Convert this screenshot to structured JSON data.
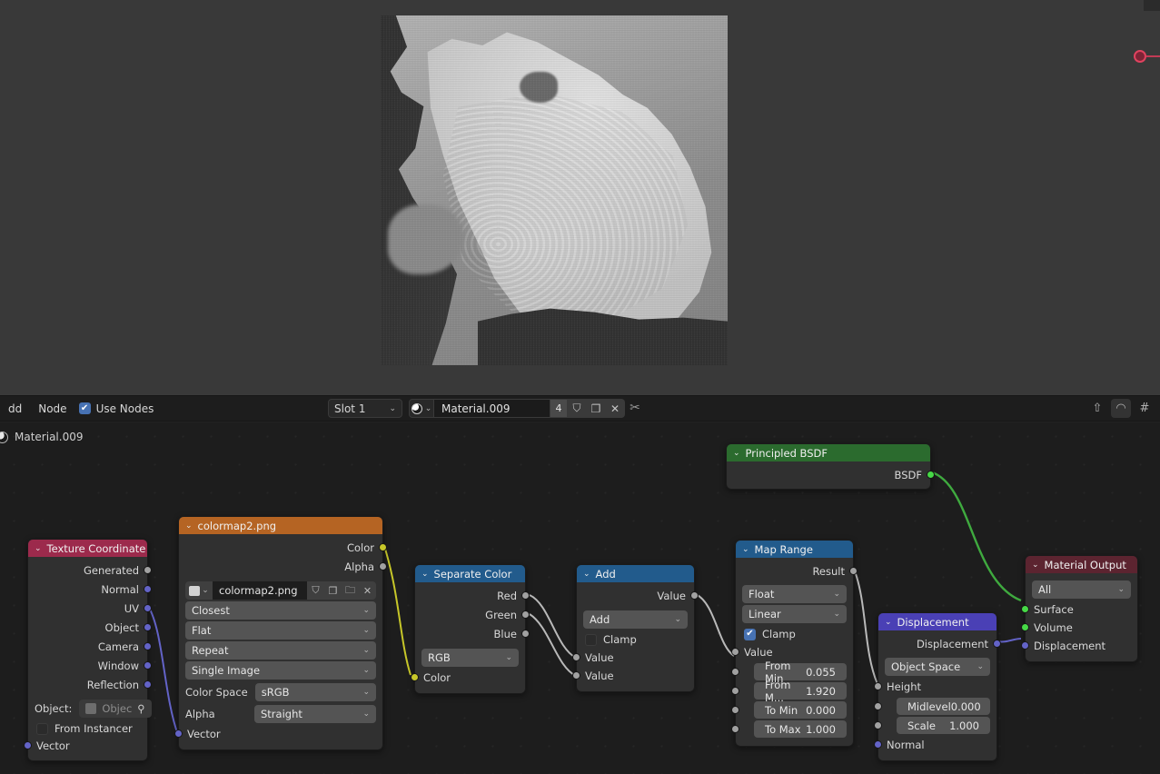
{
  "app": {
    "title": "Blender Shader Editor"
  },
  "header": {
    "menu_add": "dd",
    "menu_node": "Node",
    "use_nodes_label": "Use Nodes",
    "use_nodes_checked": true,
    "slot_value": "Slot 1",
    "material_name": "Material.009",
    "users_count": "4",
    "fake_user_icon": "shield-icon",
    "duplicate_icon": "copy-icon",
    "unlink_icon": "x-icon",
    "pin_icon": "pin-icon",
    "snap_icon": "snap-magnet-icon",
    "proportional_icon": "proportional-edit-icon",
    "overlay_icon": "overlays-icon"
  },
  "breadcrumb": {
    "icon": "material-sphere-icon",
    "label": "Material.009"
  },
  "preview": {
    "alt": "grayscale displacement shaded render of a shell-like object"
  },
  "nodes": {
    "texture_coordinate": {
      "title": "Texture Coordinate",
      "header_color": "#9c2a4c",
      "outputs": [
        "Generated",
        "Normal",
        "UV",
        "Object",
        "Camera",
        "Window",
        "Reflection"
      ],
      "object_label": "Object:",
      "object_value": "Objec",
      "object_eyedropper_icon": "eyedropper-icon",
      "from_instancer_label": "From Instancer",
      "from_instancer_checked": false,
      "inputs": [
        "Vector"
      ]
    },
    "image_texture": {
      "title": "colormap2.png",
      "header_color": "#b56423",
      "outputs": [
        "Color",
        "Alpha"
      ],
      "image_browse_icon": "image-icon",
      "image_name": "colormap2.png",
      "fake_user_icon": "shield-icon",
      "new_image_icon": "copy-icon",
      "open_image_icon": "folder-icon",
      "unlink_icon": "x-icon",
      "interpolation": "Closest",
      "projection": "Flat",
      "extension": "Repeat",
      "source": "Single Image",
      "color_space_label": "Color Space",
      "color_space_value": "sRGB",
      "alpha_label": "Alpha",
      "alpha_value": "Straight",
      "inputs": [
        "Vector"
      ]
    },
    "separate_color": {
      "title": "Separate Color",
      "header_color": "#225b8c",
      "outputs": [
        "Red",
        "Green",
        "Blue"
      ],
      "mode": "RGB",
      "inputs": [
        "Color"
      ]
    },
    "add_math": {
      "title": "Add",
      "header_color": "#225b8c",
      "outputs": [
        "Value"
      ],
      "operation": "Add",
      "clamp_label": "Clamp",
      "clamp_checked": false,
      "inputs": [
        "Value",
        "Value"
      ]
    },
    "map_range": {
      "title": "Map Range",
      "header_color": "#225b8c",
      "outputs": [
        "Result"
      ],
      "data_type": "Float",
      "interpolation": "Linear",
      "clamp_label": "Clamp",
      "clamp_checked": true,
      "input_label": "Value",
      "fields": [
        {
          "label": "From Min",
          "value": "0.055"
        },
        {
          "label": "From M...",
          "value": "1.920"
        },
        {
          "label": "To Min",
          "value": "0.000"
        },
        {
          "label": "To Max",
          "value": "1.000"
        }
      ]
    },
    "displacement": {
      "title": "Displacement",
      "header_color": "#4a40b5",
      "outputs": [
        "Displacement"
      ],
      "space": "Object Space",
      "height_label": "Height",
      "fields": [
        {
          "label": "Midlevel",
          "value": "0.000"
        },
        {
          "label": "Scale",
          "value": "1.000"
        }
      ],
      "normal_label": "Normal"
    },
    "principled_bsdf": {
      "title": "Principled BSDF",
      "header_color": "#2b6b2e",
      "outputs": [
        "BSDF"
      ]
    },
    "material_output": {
      "title": "Material Output",
      "header_color": "#5c2430",
      "target": "All",
      "inputs": [
        "Surface",
        "Volume",
        "Displacement"
      ]
    }
  },
  "links": [
    {
      "from": "texture_coordinate.UV",
      "to": "image_texture.Vector",
      "color": "#6363c7"
    },
    {
      "from": "image_texture.Color",
      "to": "separate_color.Color",
      "color": "#c7c729"
    },
    {
      "from": "separate_color.Red",
      "to": "add_math.Value1",
      "color": "#b9b9b9"
    },
    {
      "from": "separate_color.Green",
      "to": "add_math.Value2",
      "color": "#b9b9b9"
    },
    {
      "from": "add_math.Value",
      "to": "map_range.Value",
      "color": "#b9b9b9"
    },
    {
      "from": "map_range.Result",
      "to": "displacement.Height",
      "color": "#b9b9b9"
    },
    {
      "from": "displacement.Displacement",
      "to": "material_output.Displacement",
      "color": "#6363c7"
    },
    {
      "from": "principled_bsdf.BSDF",
      "to": "material_output.Surface",
      "color": "#3faa3f"
    }
  ]
}
